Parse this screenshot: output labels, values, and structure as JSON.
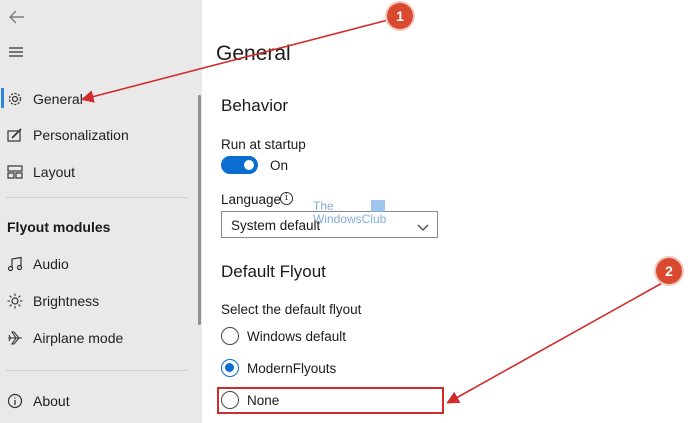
{
  "sidebar": {
    "items": [
      {
        "label": "General",
        "icon": "gear-icon"
      },
      {
        "label": "Personalization",
        "icon": "pen-icon"
      },
      {
        "label": "Layout",
        "icon": "layout-icon"
      }
    ],
    "section_title": "Flyout modules",
    "modules": [
      {
        "label": "Audio",
        "icon": "music-note-icon"
      },
      {
        "label": "Brightness",
        "icon": "sun-icon"
      },
      {
        "label": "Airplane mode",
        "icon": "airplane-icon"
      }
    ],
    "about_label": "About"
  },
  "main": {
    "title": "General",
    "behavior": {
      "heading": "Behavior",
      "run_at_startup_label": "Run at startup",
      "run_at_startup_state": "On",
      "language_label": "Language",
      "language_value": "System default"
    },
    "default_flyout": {
      "heading": "Default Flyout",
      "select_label": "Select the default flyout",
      "options": [
        "Windows default",
        "ModernFlyouts",
        "None"
      ],
      "selected": "ModernFlyouts"
    }
  },
  "watermark": {
    "line1": "The",
    "line2": "WindowsClub"
  },
  "callouts": [
    "1",
    "2"
  ],
  "colors": {
    "accent": "#0a6ed1",
    "annotation": "#d9492f",
    "sidebar_bg": "#e9e9e9"
  }
}
